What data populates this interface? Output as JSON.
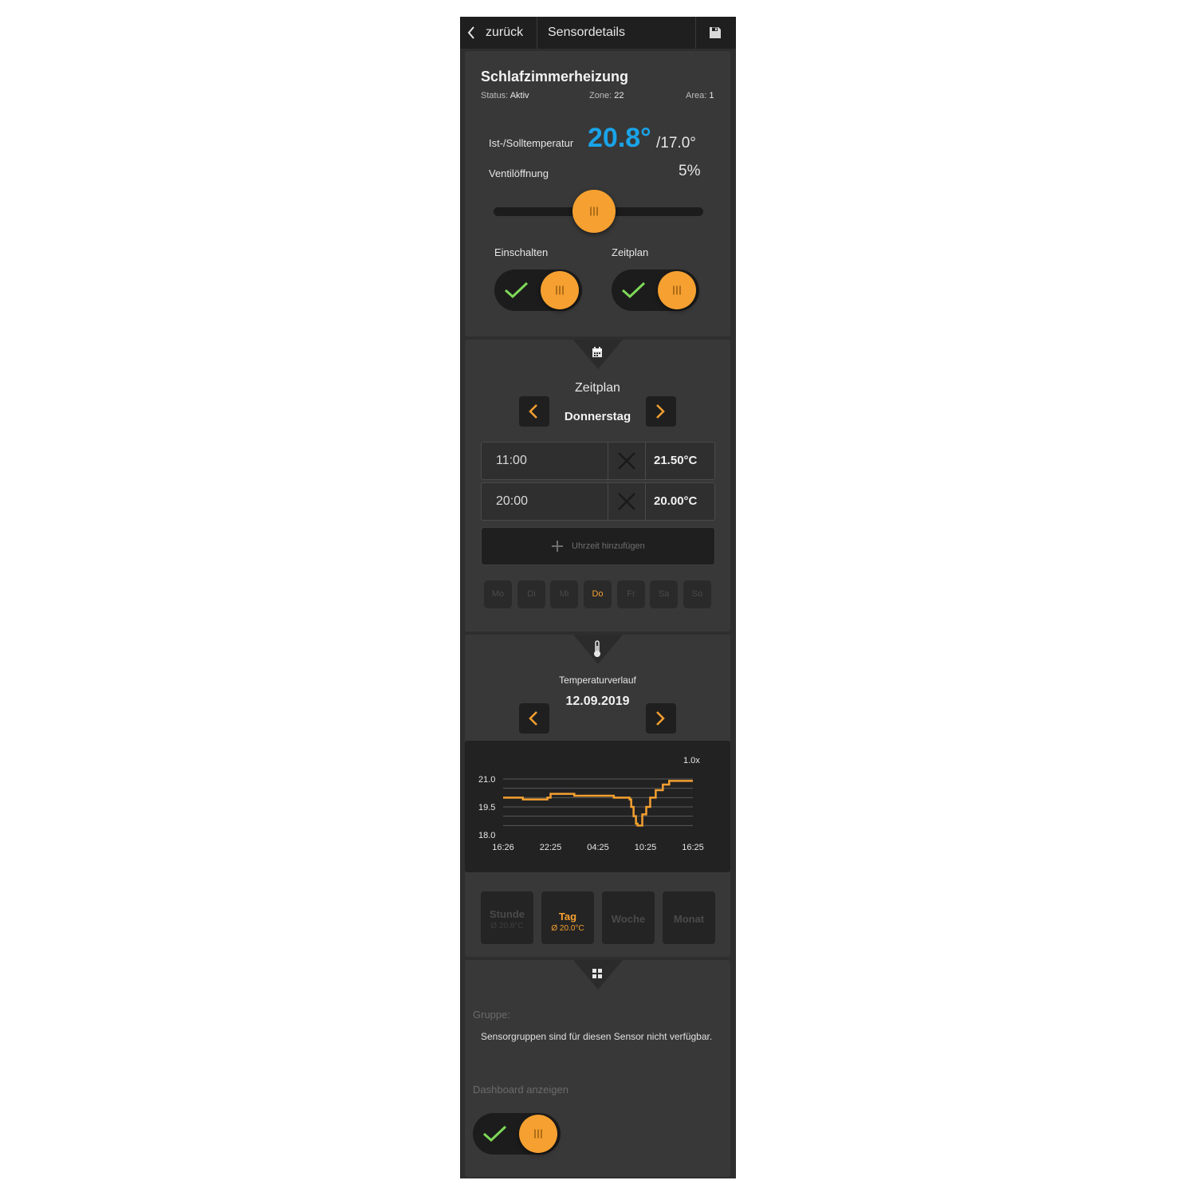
{
  "header": {
    "back_label": "zurück",
    "title": "Sensordetails",
    "back_icon": "chevron-left-icon",
    "save_icon": "floppy-disk-icon"
  },
  "sensor": {
    "name": "Schlafzimmerheizung",
    "status_label": "Status:",
    "status_value": "Aktiv",
    "zone_label": "Zone:",
    "zone_value": "22",
    "area_label": "Area:",
    "area_value": "1",
    "temp_label": "Ist-/Solltemperatur",
    "temp_current": "20.8°",
    "temp_target": "/17.0°",
    "valve_label": "Ventilöffnung",
    "valve_value": "5%",
    "valve_slider_fraction": 0.48,
    "switch_on_label": "Einschalten",
    "switch_on_state": true,
    "schedule_label": "Zeitplan",
    "schedule_state": true
  },
  "schedule": {
    "icon": "calendar-icon",
    "title": "Zeitplan",
    "day": "Donnerstag",
    "entries": [
      {
        "time": "11:00",
        "temp": "21.50°C"
      },
      {
        "time": "20:00",
        "temp": "20.00°C"
      }
    ],
    "add_label": "Uhrzeit hinzufügen",
    "weekdays": [
      "Mo",
      "Di",
      "Mi",
      "Do",
      "Fr",
      "Sa",
      "So"
    ],
    "active_weekday": "Do"
  },
  "temperature": {
    "icon": "thermometer-icon",
    "title": "Temperaturverlauf",
    "date": "12.09.2019",
    "zoom": "1.0x",
    "ranges": [
      {
        "label": "Stunde",
        "avg": "Ø 20.8°C",
        "active": false
      },
      {
        "label": "Tag",
        "avg": "Ø 20.0°C",
        "active": true
      },
      {
        "label": "Woche",
        "avg": "",
        "active": false
      },
      {
        "label": "Monat",
        "avg": "",
        "active": false
      }
    ]
  },
  "chart_data": {
    "type": "line",
    "x_ticks": [
      "16:26",
      "22:25",
      "04:25",
      "10:25",
      "16:25"
    ],
    "y_ticks": [
      "21.0",
      "19.5",
      "18.0"
    ],
    "ylim": [
      18.0,
      21.0
    ],
    "xlim_hours": [
      0,
      24
    ],
    "grid": true,
    "colors": {
      "line": "#f5a030",
      "grid": "#5a5a5a"
    },
    "series": [
      {
        "x": [
          0,
          1.5,
          2.5,
          3.2,
          5,
          5.6,
          6,
          6.5,
          9,
          10,
          13,
          14,
          16,
          16.2,
          16.5,
          16.8,
          17,
          17.3,
          17.6,
          18.1,
          18.6,
          19.3,
          20.2,
          21,
          24
        ],
        "y": [
          20.0,
          20.0,
          19.9,
          19.9,
          19.9,
          20.0,
          20.2,
          20.2,
          20.1,
          20.1,
          20.1,
          20.0,
          19.9,
          19.5,
          19.0,
          18.6,
          18.5,
          18.5,
          19.1,
          19.5,
          20.0,
          20.4,
          20.7,
          20.9,
          20.9
        ]
      }
    ]
  },
  "group": {
    "icon": "grid-icon",
    "label": "Gruppe:",
    "text": "Sensorgruppen sind für diesen Sensor nicht verfügbar.",
    "dashboard_label": "Dashboard anzeigen",
    "dashboard_state": true
  }
}
